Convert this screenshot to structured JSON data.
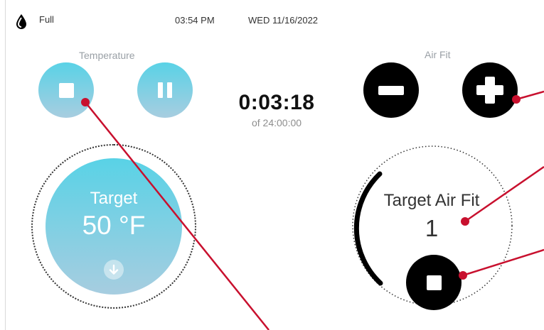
{
  "status_bar": {
    "level_icon": "water-drop-icon",
    "level": "Full",
    "time": "03:54 PM",
    "date": "WED 11/16/2022"
  },
  "temperature": {
    "label": "Temperature",
    "stop_icon": "stop-icon",
    "pause_icon": "pause-icon",
    "dial_title": "Target",
    "dial_value": "50 °F",
    "arrow_icon": "arrow-down-icon"
  },
  "timer": {
    "elapsed": "0:03:18",
    "total": "of 24:00:00"
  },
  "air_fit": {
    "label": "Air Fit",
    "minus_icon": "minus-icon",
    "plus_icon": "plus-icon",
    "dial_title": "Target Air Fit",
    "dial_value": "1",
    "stop_icon": "stop-icon"
  },
  "colors": {
    "gradient_top": "#59d2e6",
    "gradient_bottom": "#a7cde0",
    "annotation": "#c8102e"
  }
}
